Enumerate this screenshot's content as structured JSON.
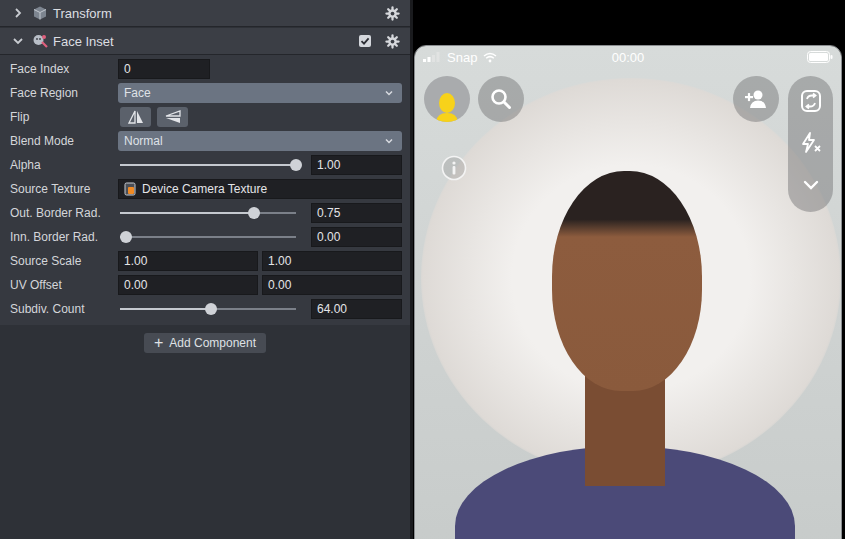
{
  "inspector": {
    "transform": {
      "title": "Transform",
      "expanded": false
    },
    "face_inset": {
      "title": "Face Inset",
      "expanded": true,
      "enabled": true,
      "properties": [
        {
          "kind": "number",
          "label": "Face Index",
          "value": "0"
        },
        {
          "kind": "dropdown",
          "label": "Face Region",
          "value": "Face"
        },
        {
          "kind": "flip",
          "label": "Flip",
          "buttons": [
            {
              "on": false
            },
            {
              "on": false
            }
          ]
        },
        {
          "kind": "dropdown",
          "label": "Blend Mode",
          "value": "Normal"
        },
        {
          "kind": "slider",
          "label": "Alpha",
          "level": 1.0,
          "value": "1.00"
        },
        {
          "kind": "texture",
          "label": "Source Texture",
          "value": "Device Camera Texture"
        },
        {
          "kind": "slider",
          "label": "Out. Border Rad.",
          "level": 0.75,
          "value": "0.75"
        },
        {
          "kind": "slider",
          "label": "Inn. Border Rad.",
          "level": 0,
          "value": "0.00"
        },
        {
          "kind": "pair",
          "label": "Source Scale",
          "values": [
            "1.00",
            "1.00"
          ]
        },
        {
          "kind": "pair",
          "label": "UV Offset",
          "values": [
            "0.00",
            "0.00"
          ]
        },
        {
          "kind": "slider",
          "label": "Subdiv. Count",
          "level": 0.5,
          "value": "64.00"
        }
      ]
    },
    "add_component": {
      "icon": "+",
      "label": "Add Component"
    }
  },
  "preview": {
    "status_bar": {
      "carrier": "Snap",
      "time": "00:00"
    }
  }
}
